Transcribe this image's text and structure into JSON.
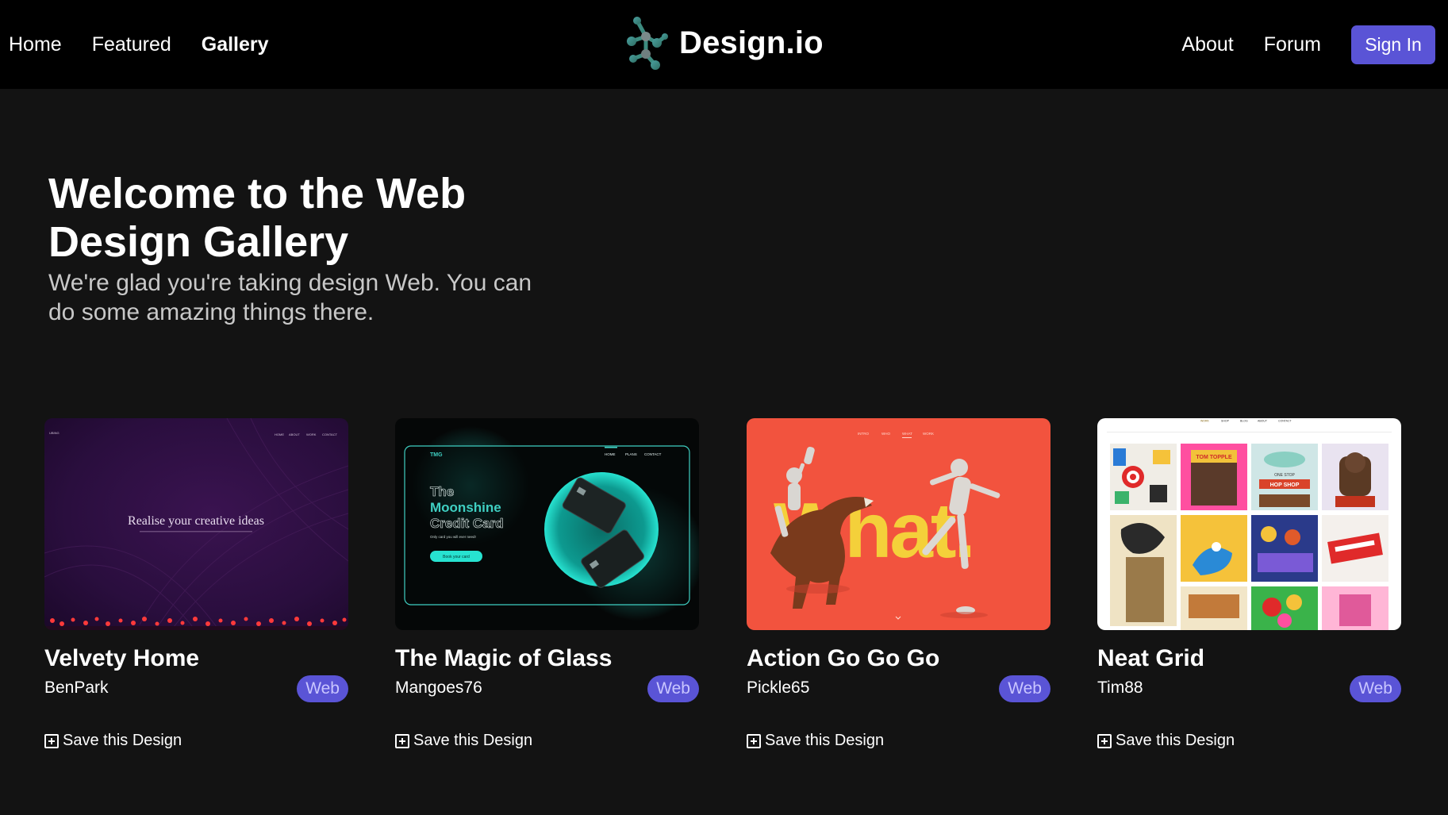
{
  "nav": {
    "left": [
      "Home",
      "Featured",
      "Gallery"
    ],
    "active": "Gallery",
    "brand": "Design.io",
    "right": [
      "About",
      "Forum"
    ],
    "signin": "Sign In"
  },
  "hero": {
    "title_line1": "Welcome to the Web",
    "title_line2": "Design Gallery",
    "subtitle_line1": "We're glad you're taking design Web. You can",
    "subtitle_line2": "do some amazing things there."
  },
  "cards": [
    {
      "title": "Velvety Home",
      "author": "BenPark",
      "tag": "Web",
      "save": "Save this Design",
      "thumb": {
        "headline": "Realise your creative ideas",
        "nav_items": [
          "HOME",
          "ABOUT",
          "WORK",
          "CONTACT"
        ]
      }
    },
    {
      "title": "The Magic of Glass",
      "author": "Mangoes76",
      "tag": "Web",
      "save": "Save this Design",
      "thumb": {
        "logo": "TMG",
        "nav_items": [
          "HOME",
          "PLANS",
          "CONTACT"
        ],
        "line1": "The",
        "line2": "Moonshine",
        "line3": "Credit Card",
        "small": "Only card you will ever need!",
        "cta": "Book your card"
      }
    },
    {
      "title": "Action Go Go Go",
      "author": "Pickle65",
      "tag": "Web",
      "save": "Save this Design",
      "thumb": {
        "nav_items": [
          "INTRO",
          "WHO",
          "WHAT",
          "WORK"
        ],
        "big_word": "What."
      }
    },
    {
      "title": "Neat Grid",
      "author": "Tim88",
      "tag": "Web",
      "save": "Save this Design",
      "thumb": {
        "nav_items": [
          "WORK",
          "SHOP",
          "BLOG",
          "ABOUT",
          "CONTACT"
        ],
        "poster1": "TOM TOPPLE",
        "poster2": "ONE STOP",
        "poster3": "HOP SHOP"
      }
    }
  ],
  "colors": {
    "accent": "#5a54d6",
    "background": "#131313",
    "navbar": "#000000",
    "tag_text": "#c9c6ff"
  },
  "icons": {
    "logo": "hexagon-molecule-logo-icon",
    "save": "plus-square-icon"
  }
}
